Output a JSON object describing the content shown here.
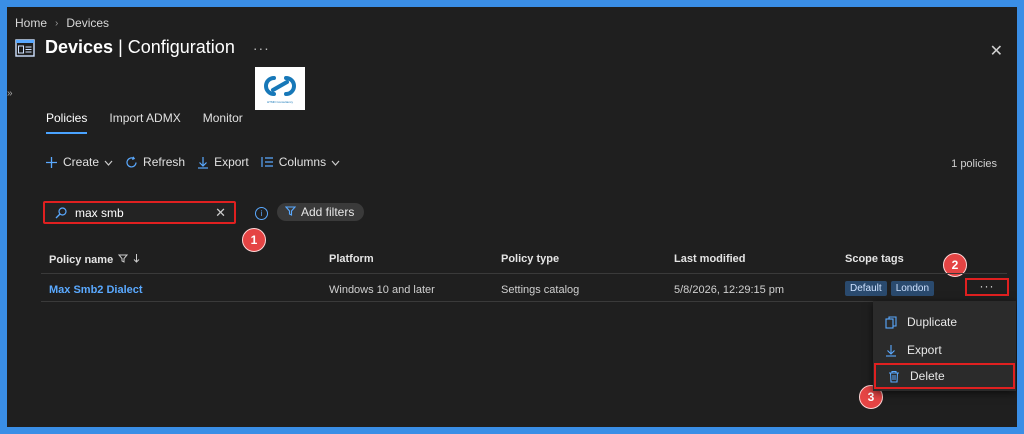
{
  "breadcrumb": {
    "home": "Home",
    "current": "Devices",
    "separator": "›"
  },
  "header": {
    "title_bold": "Devices",
    "title_rest": "| Configuration",
    "more": "···",
    "close": "✕"
  },
  "logo": {
    "tagline": "HTMD Consultancy"
  },
  "tabs": [
    {
      "label": "Policies",
      "active": true
    },
    {
      "label": "Import ADMX",
      "active": false
    },
    {
      "label": "Monitor",
      "active": false
    }
  ],
  "toolbar": {
    "create": "Create",
    "refresh": "Refresh",
    "export": "Export",
    "columns": "Columns"
  },
  "policy_count": "1 policies",
  "search": {
    "value": "max smb",
    "clear": "✕"
  },
  "filters": {
    "add_label": "Add filters"
  },
  "table": {
    "headers": [
      "Policy name",
      "Platform",
      "Policy type",
      "Last modified",
      "Scope tags"
    ],
    "rows": [
      {
        "policy_name": "Max Smb2 Dialect",
        "platform": "Windows 10 and later",
        "policy_type": "Settings catalog",
        "last_modified": "5/8/2026, 12:29:15 pm",
        "scope_tags": [
          "Default",
          "London"
        ],
        "more": "···"
      }
    ]
  },
  "context_menu": {
    "duplicate": "Duplicate",
    "export": "Export",
    "delete": "Delete"
  },
  "steps": [
    "1",
    "2",
    "3"
  ],
  "colors": {
    "accent": "#5aa9ff",
    "highlight": "#e02020",
    "badge": "#e54444",
    "background": "#1f1f1f",
    "border": "#3a8ee6"
  }
}
